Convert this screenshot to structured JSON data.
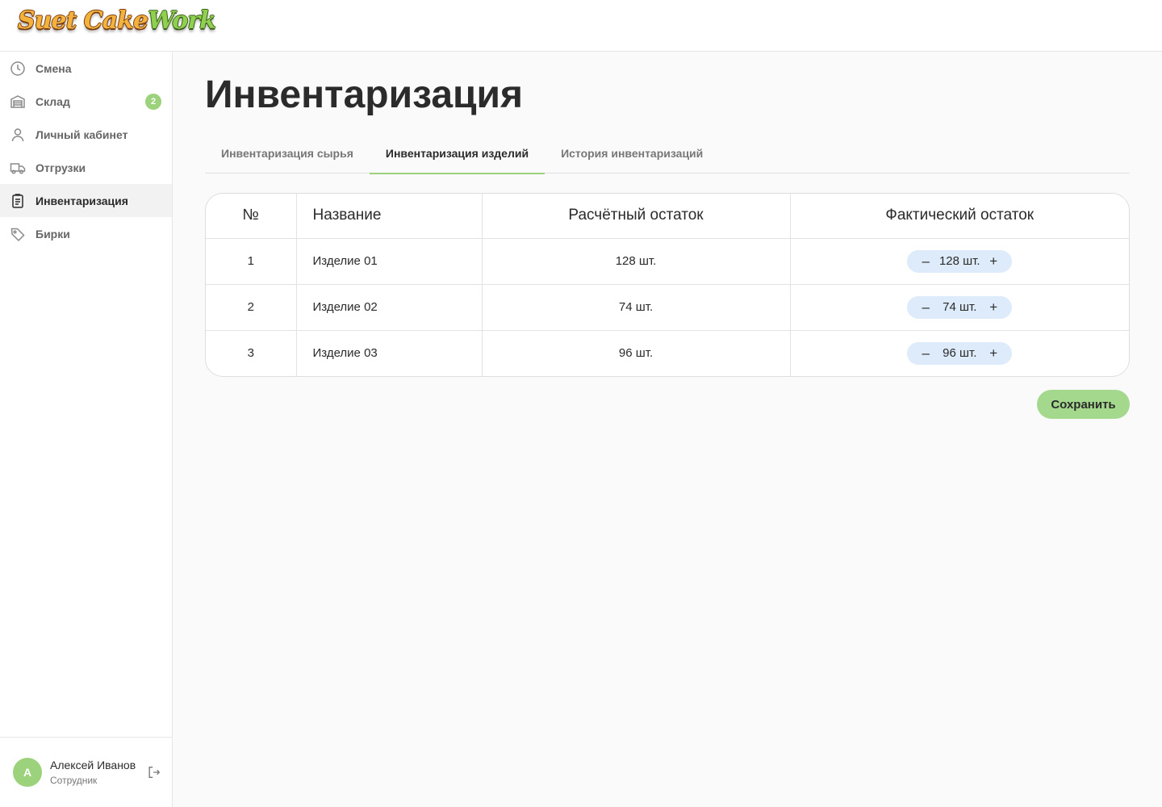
{
  "header": {
    "logo": {
      "word1": "Suet Cake",
      "word2": "Work"
    }
  },
  "sidebar": {
    "items": [
      {
        "label": "Смена",
        "icon": "clock-icon"
      },
      {
        "label": "Склад",
        "icon": "warehouse-icon",
        "badge": "2"
      },
      {
        "label": "Личный кабинет",
        "icon": "user-icon"
      },
      {
        "label": "Отгрузки",
        "icon": "truck-icon"
      },
      {
        "label": "Инвентаризация",
        "icon": "clipboard-icon",
        "active": true
      },
      {
        "label": "Бирки",
        "icon": "tag-icon"
      }
    ],
    "user": {
      "initial": "А",
      "name": "Алексей Иванов",
      "role": "Сотрудник"
    }
  },
  "main": {
    "title": "Инвентаризация",
    "tabs": [
      {
        "label": "Инвентаризация сырья"
      },
      {
        "label": "Инвентаризация изделий",
        "active": true
      },
      {
        "label": "История инвентаризаций"
      }
    ],
    "table": {
      "headers": [
        "№",
        "Название",
        "Расчётный остаток",
        "Фактический остаток"
      ],
      "rows": [
        {
          "num": "1",
          "name": "Изделие 01",
          "calc": "128 шт.",
          "fact": "128 шт."
        },
        {
          "num": "2",
          "name": "Изделие 02",
          "calc": "74 шт.",
          "fact": "74 шт."
        },
        {
          "num": "3",
          "name": "Изделие 03",
          "calc": "96 шт.",
          "fact": "96 шт."
        }
      ],
      "minus": "–",
      "plus": "+"
    },
    "save_label": "Сохранить"
  },
  "colors": {
    "accent": "#9cd27b",
    "stepper_bg": "#ddebfb",
    "save_bg": "#a4d88c"
  }
}
